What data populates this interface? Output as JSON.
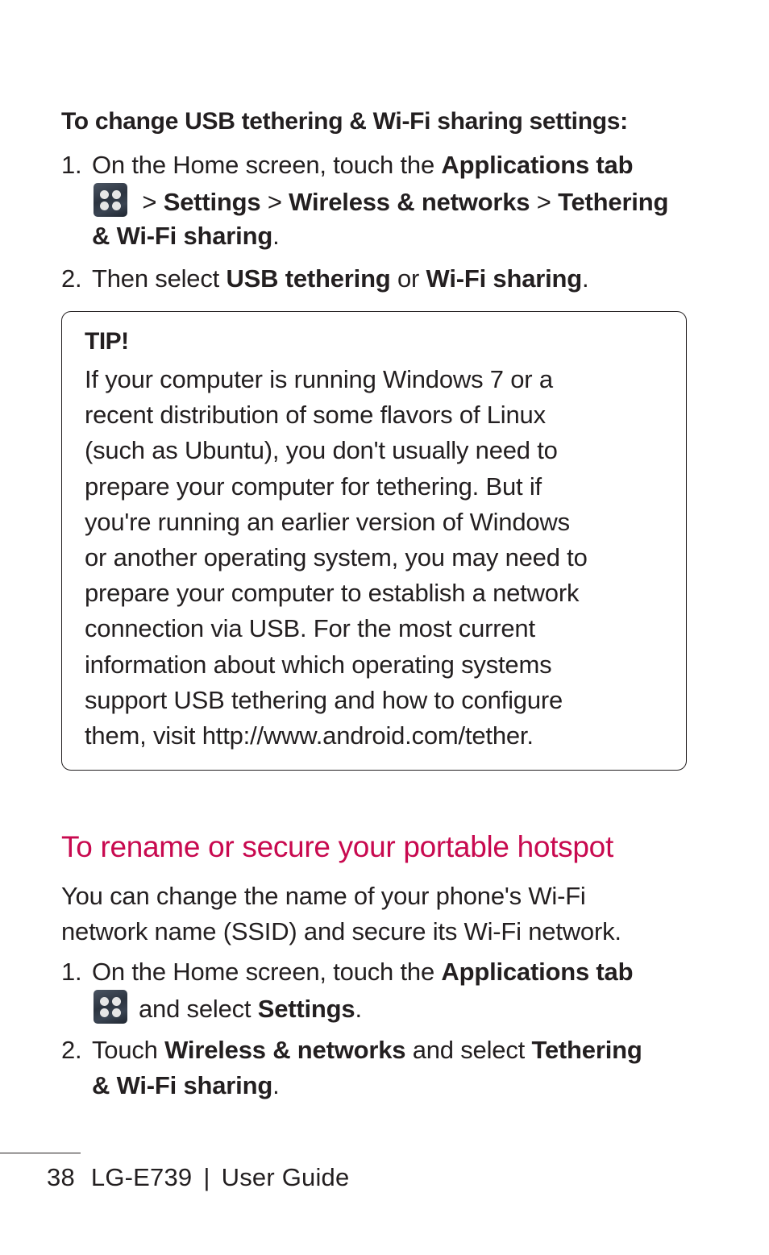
{
  "section1": {
    "subheading": "To change USB tethering & Wi-Fi sharing settings:",
    "steps": [
      {
        "number": "1.",
        "text_a": "On the Home screen, touch the ",
        "bold_a": "Applications tab",
        "icon": "applications-grid-icon",
        "sep1": " > ",
        "bold_b": "Settings",
        "sep2": " > ",
        "bold_c": "Wireless & networks",
        "sep3": " > ",
        "bold_d": "Tethering",
        "bold_e": "& Wi-Fi sharing",
        "end": "."
      },
      {
        "number": "2.",
        "text_a": "Then select ",
        "bold_a": "USB tethering",
        "text_b": " or ",
        "bold_b": "Wi-Fi sharing",
        "end": "."
      }
    ]
  },
  "tip": {
    "title": "TIP!",
    "lines": [
      "If your computer is running Windows 7 or a",
      "recent distribution of some flavors of Linux",
      "(such as Ubuntu), you don't usually need to",
      "prepare your computer for tethering. But if",
      "you're running an earlier version of Windows",
      "or another operating system, you may need to",
      "prepare your computer to establish a network",
      "connection via USB. For the most current",
      "information about which operating systems",
      "support USB tethering and how to configure",
      "them, visit http://www.android.com/tether."
    ]
  },
  "section2": {
    "heading": "To rename or secure your portable hotspot",
    "heading_color": "#c8094f",
    "intro_lines": [
      "You can change the name of your phone's Wi-Fi",
      "network name (SSID) and secure its Wi-Fi network."
    ],
    "steps": [
      {
        "number": "1.",
        "text_a": "On the Home screen, touch the ",
        "bold_a": "Applications tab",
        "icon": "applications-grid-icon",
        "text_b": "and select ",
        "bold_b": "Settings",
        "end": "."
      },
      {
        "number": "2.",
        "text_a": "Touch ",
        "bold_a": "Wireless & networks",
        "text_b": " and select ",
        "bold_b": "Tethering",
        "bold_c": "& Wi-Fi sharing",
        "end": "."
      }
    ]
  },
  "footer": {
    "page_number": "38",
    "model": "LG-E739",
    "separator": "|",
    "guide": "User Guide"
  }
}
